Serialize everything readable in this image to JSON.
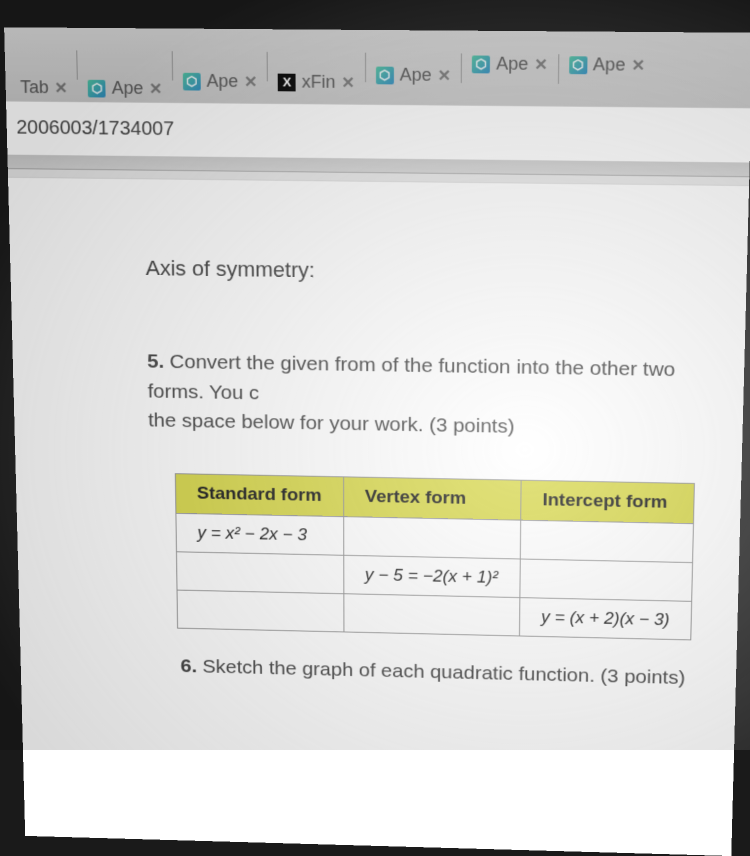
{
  "tabs": [
    {
      "icon": "none",
      "label": "Tab",
      "cls": "lower"
    },
    {
      "icon": "ape",
      "label": "Ape",
      "cls": "lower"
    },
    {
      "icon": "ape",
      "label": "Ape",
      "cls": "low1"
    },
    {
      "icon": "x",
      "label": "xFin",
      "cls": "low1"
    },
    {
      "icon": "ape",
      "label": "Ape",
      "cls": "low2"
    },
    {
      "icon": "ape",
      "label": "Ape",
      "cls": ""
    },
    {
      "icon": "ape",
      "label": "Ape",
      "cls": ""
    }
  ],
  "url_fragment": "2006003/1734007",
  "axis_label": "Axis of symmetry:",
  "q5": {
    "num": "5.",
    "line1": " Convert the given from of the function into the other two forms. You c",
    "line2": "the space below for your work. (3 points)"
  },
  "table": {
    "headers": [
      "Standard form",
      "Vertex form",
      "Intercept form"
    ],
    "rows": [
      [
        "y = x² − 2x − 3",
        "",
        ""
      ],
      [
        "",
        "y − 5 = −2(x + 1)²",
        ""
      ],
      [
        "",
        "",
        "y = (x + 2)(x − 3)"
      ]
    ]
  },
  "q6": {
    "num": "6.",
    "text": " Sketch the graph of each quadratic function. (3 points)"
  }
}
